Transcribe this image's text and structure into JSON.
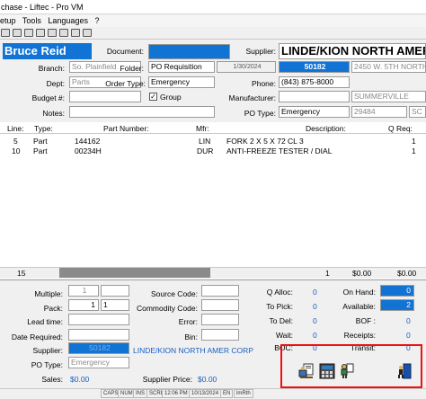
{
  "window": {
    "title": "chase - Liftec - Pro VM"
  },
  "menu": {
    "items": [
      "etup",
      "Tools",
      "Languages",
      "?"
    ]
  },
  "header": {
    "buyer_name": "Bruce Reid",
    "document_label": "Document:",
    "document_value": "",
    "supplier_label": "Supplier:",
    "supplier_name": "LINDE/KION NORTH AMER",
    "branch_label": "Branch:",
    "branch_value": "So. Plainfield",
    "folder_label": "Folder:",
    "folder_value": "PO Requisition",
    "date_value": "1/30/2024",
    "supplier_code": "50182",
    "supplier_address": "2450 W. 5TH NORTH",
    "dept_label": "Dept:",
    "dept_value": "Parts",
    "order_type_label": "Order Type:",
    "order_type_value": "Emergency",
    "phone_label": "Phone:",
    "phone_value": "(843) 875-8000",
    "group_label": "Group",
    "budget_label": "Budget #:",
    "budget_value": "",
    "manufacturer_label": "Manufacturer:",
    "manufacturer_value": "",
    "city_value": "SUMMERVILLE",
    "notes_label": "Notes:",
    "notes_value": "",
    "po_type_label": "PO Type:",
    "po_type_value": "Emergency",
    "zip_value": "29484",
    "state_value": "SC"
  },
  "grid": {
    "columns": [
      "Line:",
      "Type:",
      "Part Number:",
      "Mfr:",
      "Description:",
      "Q Req:"
    ],
    "rows": [
      {
        "line": "5",
        "type": "Part",
        "part": "144162",
        "mfr": "LIN",
        "desc": "FORK 2 X 5 X 72 CL 3",
        "qty": "1"
      },
      {
        "line": "10",
        "type": "Part",
        "part": "00234H",
        "mfr": "DUR",
        "desc": "ANTI-FREEZE TESTER / DIAL",
        "qty": "1"
      }
    ],
    "total_row": {
      "line": "15",
      "qty": "1",
      "amount": "$0.00",
      "amount2": "$0.00"
    }
  },
  "detail": {
    "multiple_label": "Multiple:",
    "multiple_1": "1",
    "multiple_2": "1",
    "pack_label": "Pack:",
    "pack_1": "1",
    "pack_2": "1",
    "lead_label": "Lead time:",
    "date_req_label": "Date Required:",
    "supplier_label": "Supplier:",
    "supplier_code": "50182",
    "supplier_name": "LINDE/KION NORTH AMER CORP",
    "po_type_label": "PO Type:",
    "po_type_value": "Emergency",
    "sales_label": "Sales:",
    "sales_value": "$0.00",
    "supplier_price_label": "Supplier Price:",
    "supplier_price_value": "$0.00",
    "source_code_label": "Source Code:",
    "commodity_code_label": "Commodity Code:",
    "error_label": "Error:",
    "bin_label": "Bin:",
    "q_alloc_label": "Q Alloc:",
    "q_alloc_value": "0",
    "to_pick_label": "To Pick:",
    "to_pick_value": "0",
    "to_del_label": "To Del:",
    "to_del_value": "0",
    "wait_label": "Wait:",
    "wait_value": "0",
    "boc_label": "BOC:",
    "boc_value": "0",
    "on_hand_label": "On Hand:",
    "on_hand_value": "0",
    "available_label": "Available:",
    "available_value": "2",
    "bof_label": "BOF :",
    "bof_value": "0",
    "receipts_label": "Receipts:",
    "receipts_value": "0",
    "transit_label": "Transit:",
    "transit_value": "0"
  },
  "statusbar": {
    "caps": "CAPS",
    "num": "NUM",
    "ins": "INS",
    "scrl": "SCRL",
    "time": "12:06 PM",
    "date": "10/13/2024",
    "lang": "EN",
    "user": "lmRth"
  },
  "colors": {
    "accent": "#1174d4",
    "highlight_box": "#e11111",
    "link": "#1a5fc4"
  },
  "icons": [
    "print-doc-icon",
    "calculator-icon",
    "person-cart-icon",
    "exit-door-icon"
  ]
}
